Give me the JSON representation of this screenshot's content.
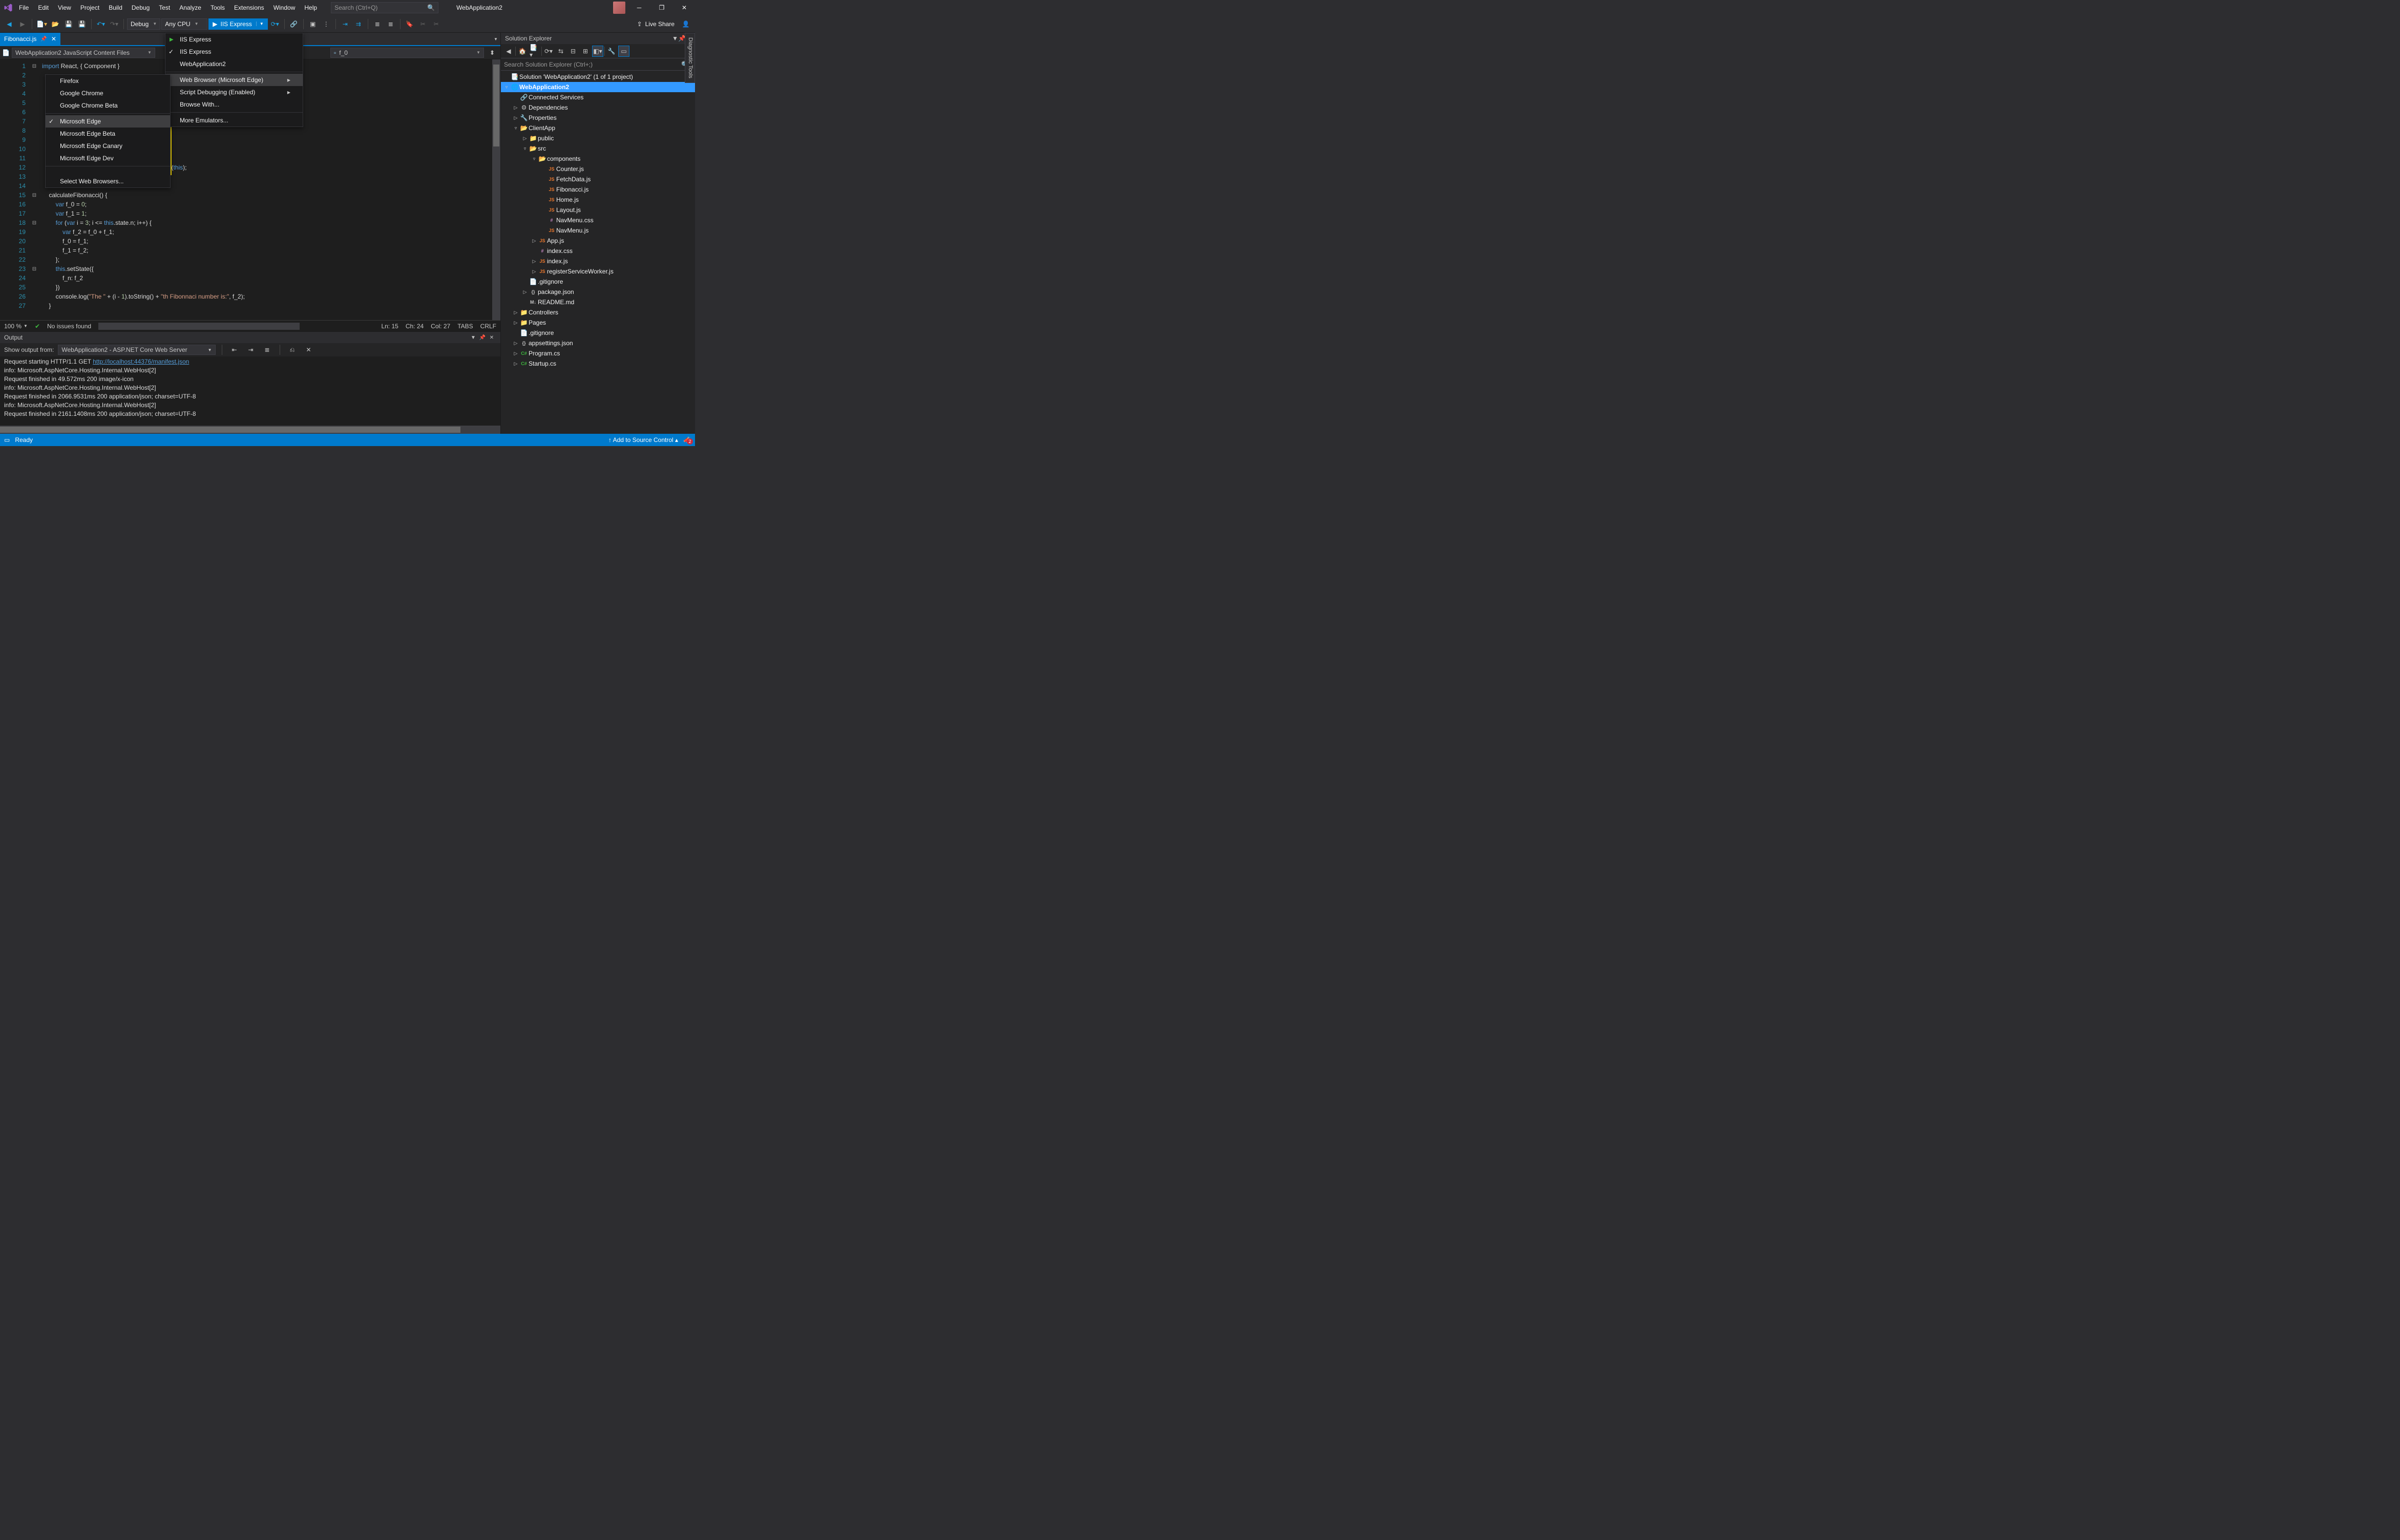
{
  "titlebar": {
    "menus": [
      "File",
      "Edit",
      "View",
      "Project",
      "Build",
      "Debug",
      "Test",
      "Analyze",
      "Tools",
      "Extensions",
      "Window",
      "Help"
    ],
    "search_placeholder": "Search (Ctrl+Q)",
    "solution_name": "WebApplication2"
  },
  "toolbar": {
    "config": "Debug",
    "platform": "Any CPU",
    "run_label": "IIS Express",
    "live_share": "Live Share"
  },
  "run_dropdown": {
    "items": [
      {
        "label": "IIS Express",
        "play": true
      },
      {
        "label": "IIS Express",
        "checked": true
      },
      {
        "label": "WebApplication2"
      }
    ],
    "section2": [
      {
        "label": "Web Browser (Microsoft Edge)",
        "submenu": true,
        "hover": true
      },
      {
        "label": "Script Debugging (Enabled)",
        "submenu": true
      },
      {
        "label": "Browse With..."
      }
    ],
    "section3": [
      {
        "label": "More Emulators..."
      }
    ]
  },
  "browser_submenu": {
    "items1": [
      {
        "label": "Firefox"
      },
      {
        "label": "Google Chrome"
      },
      {
        "label": "Google Chrome Beta"
      }
    ],
    "ms_items": [
      {
        "label": "Microsoft Edge",
        "checked": true,
        "hover": true
      },
      {
        "label": "Microsoft Edge Beta"
      },
      {
        "label": "Microsoft Edge Canary"
      },
      {
        "label": "Microsoft Edge Dev"
      }
    ],
    "footer": [
      {
        "label": "Select Web Browsers..."
      }
    ]
  },
  "editor": {
    "tab": "Fibonacci.js",
    "scope_combo": "WebApplication2 JavaScript Content Files",
    "member_combo": "f_0",
    "line_numbers": [
      1,
      2,
      3,
      4,
      5,
      6,
      7,
      8,
      9,
      10,
      11,
      12,
      13,
      14,
      15,
      16,
      17,
      18,
      19,
      20,
      21,
      22,
      23,
      24,
      25,
      26,
      27
    ],
    "status": {
      "zoom": "100 %",
      "issues": "No issues found",
      "ln": "Ln: 15",
      "ch": "Ch: 24",
      "col": "Col: 27",
      "tabs": "TABS",
      "eol": "CRLF"
    }
  },
  "code_lines": [
    {
      "n": 1,
      "html": "<span class='kw'>import</span> React, { Component }"
    },
    {
      "n": 2,
      "html": ""
    },
    {
      "n": 3,
      "html": ""
    },
    {
      "n": 4,
      "html": ""
    },
    {
      "n": 5,
      "html": ""
    },
    {
      "n": 6,
      "html": ""
    },
    {
      "n": 7,
      "html": ""
    },
    {
      "n": 8,
      "html": ""
    },
    {
      "n": 9,
      "html": ""
    },
    {
      "n": 10,
      "html": ""
    },
    {
      "n": 11,
      "html": ""
    },
    {
      "n": 12,
      "html": "                         ci = <span class='th'>this</span>.calculateFibonacci.bind(<span class='th'>this</span>);"
    },
    {
      "n": 13,
      "html": ""
    },
    {
      "n": 14,
      "html": ""
    },
    {
      "n": 15,
      "html": "    calculateFibonacci() {"
    },
    {
      "n": 16,
      "html": "        <span class='kw'>var</span> f_0 = <span class='num'>0</span>;"
    },
    {
      "n": 17,
      "html": "        <span class='kw'>var</span> f_1 = <span class='num'>1</span>;"
    },
    {
      "n": 18,
      "html": "        <span class='kw'>for</span> (<span class='kw'>var</span> i = <span class='num'>3</span>; i &lt;= <span class='th'>this</span>.state.n; i++) {"
    },
    {
      "n": 19,
      "html": "            <span class='kw'>var</span> f_2 = f_0 + f_1;"
    },
    {
      "n": 20,
      "html": "            f_0 = f_1;"
    },
    {
      "n": 21,
      "html": "            f_1 = f_2;"
    },
    {
      "n": 22,
      "html": "        };"
    },
    {
      "n": 23,
      "html": "        <span class='th'>this</span>.setState({"
    },
    {
      "n": 24,
      "html": "            f_n: f_2"
    },
    {
      "n": 25,
      "html": "        })"
    },
    {
      "n": 26,
      "html": "        console.log(<span class='str'>\"The \"</span> + (i - <span class='num'>1</span>).toString() + <span class='str'>\"th Fibonnaci number is:\"</span>, f_2);"
    },
    {
      "n": 27,
      "html": "    }"
    }
  ],
  "output": {
    "title": "Output",
    "show_from_label": "Show output from:",
    "combo": "WebApplication2 - ASP.NET Core Web Server",
    "lines": [
      {
        "t": "      Request starting HTTP/1.1 GET ",
        "link": "http://localhost:44376/manifest.json"
      },
      {
        "t": "info: Microsoft.AspNetCore.Hosting.Internal.WebHost[2]"
      },
      {
        "t": "      Request finished in 49.572ms 200 image/x-icon"
      },
      {
        "t": "info: Microsoft.AspNetCore.Hosting.Internal.WebHost[2]"
      },
      {
        "t": "      Request finished in 2066.9531ms 200 application/json; charset=UTF-8"
      },
      {
        "t": "info: Microsoft.AspNetCore.Hosting.Internal.WebHost[2]"
      },
      {
        "t": "      Request finished in 2161.1408ms 200 application/json; charset=UTF-8"
      }
    ]
  },
  "solution_explorer": {
    "title": "Solution Explorer",
    "search_placeholder": "Search Solution Explorer (Ctrl+;)",
    "tree": [
      {
        "d": 0,
        "exp": "",
        "ico": "sln",
        "label": "Solution 'WebApplication2' (1 of 1 project)"
      },
      {
        "d": 0,
        "exp": "▿",
        "ico": "proj",
        "label": "WebApplication2",
        "bold": true,
        "selected": true
      },
      {
        "d": 1,
        "exp": "",
        "ico": "conn",
        "label": "Connected Services"
      },
      {
        "d": 1,
        "exp": "▷",
        "ico": "deps",
        "label": "Dependencies"
      },
      {
        "d": 1,
        "exp": "▷",
        "ico": "wrench",
        "label": "Properties"
      },
      {
        "d": 1,
        "exp": "▿",
        "ico": "folder-open",
        "label": "ClientApp"
      },
      {
        "d": 2,
        "exp": "▷",
        "ico": "folder",
        "label": "public"
      },
      {
        "d": 2,
        "exp": "▿",
        "ico": "folder-open",
        "label": "src"
      },
      {
        "d": 3,
        "exp": "▿",
        "ico": "folder-open",
        "label": "components"
      },
      {
        "d": 4,
        "exp": "",
        "ico": "js",
        "label": "Counter.js"
      },
      {
        "d": 4,
        "exp": "",
        "ico": "js",
        "label": "FetchData.js"
      },
      {
        "d": 4,
        "exp": "",
        "ico": "js",
        "label": "Fibonacci.js"
      },
      {
        "d": 4,
        "exp": "",
        "ico": "js",
        "label": "Home.js"
      },
      {
        "d": 4,
        "exp": "",
        "ico": "js",
        "label": "Layout.js"
      },
      {
        "d": 4,
        "exp": "",
        "ico": "css",
        "label": "NavMenu.css"
      },
      {
        "d": 4,
        "exp": "",
        "ico": "js",
        "label": "NavMenu.js"
      },
      {
        "d": 3,
        "exp": "▷",
        "ico": "js",
        "label": "App.js"
      },
      {
        "d": 3,
        "exp": "",
        "ico": "css",
        "label": "index.css"
      },
      {
        "d": 3,
        "exp": "▷",
        "ico": "js",
        "label": "index.js"
      },
      {
        "d": 3,
        "exp": "▷",
        "ico": "js",
        "label": "registerServiceWorker.js"
      },
      {
        "d": 2,
        "exp": "",
        "ico": "txt",
        "label": ".gitignore"
      },
      {
        "d": 2,
        "exp": "▷",
        "ico": "json",
        "label": "package.json"
      },
      {
        "d": 2,
        "exp": "",
        "ico": "md",
        "label": "README.md"
      },
      {
        "d": 1,
        "exp": "▷",
        "ico": "folder",
        "label": "Controllers"
      },
      {
        "d": 1,
        "exp": "▷",
        "ico": "folder",
        "label": "Pages"
      },
      {
        "d": 1,
        "exp": "",
        "ico": "txt",
        "label": ".gitignore"
      },
      {
        "d": 1,
        "exp": "▷",
        "ico": "json",
        "label": "appsettings.json"
      },
      {
        "d": 1,
        "exp": "▷",
        "ico": "cs",
        "label": "Program.cs"
      },
      {
        "d": 1,
        "exp": "▷",
        "ico": "cs",
        "label": "Startup.cs"
      }
    ]
  },
  "diag_tab": "Diagnostic Tools",
  "statusbar": {
    "ready": "Ready",
    "source_control": "Add to Source Control",
    "notifications": "2"
  }
}
